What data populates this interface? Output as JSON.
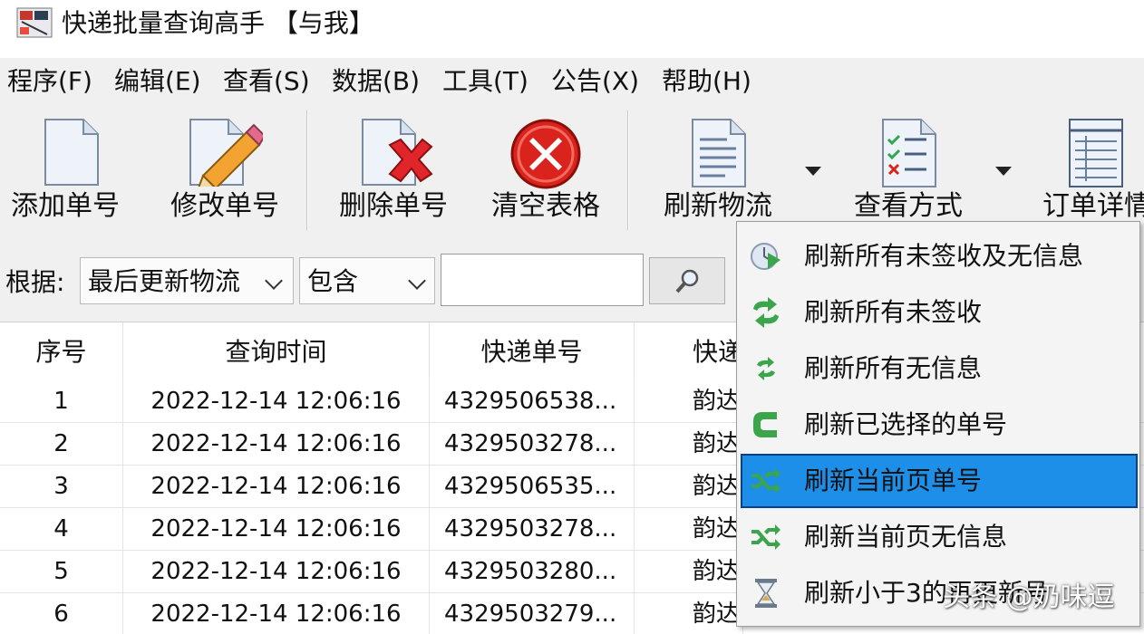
{
  "window": {
    "title": "快递批量查询高手 【与我】",
    "app_icon": "app-logo-icon"
  },
  "menubar": {
    "items": [
      "程序(F)",
      "编辑(E)",
      "查看(S)",
      "数据(B)",
      "工具(T)",
      "公告(X)",
      "帮助(H)"
    ]
  },
  "toolbar": {
    "buttons": [
      {
        "label": "添加单号",
        "icon": "document-icon"
      },
      {
        "label": "修改单号",
        "icon": "pencil-document-icon"
      },
      {
        "label": "删除单号",
        "icon": "delete-document-icon"
      },
      {
        "label": "清空表格",
        "icon": "clear-red-x-icon"
      },
      {
        "label": "刷新物流",
        "icon": "list-document-icon"
      },
      {
        "label": "查看方式",
        "icon": "checklist-icon"
      },
      {
        "label": "订单详情",
        "icon": "table-document-icon"
      }
    ]
  },
  "filter": {
    "label": "根据:",
    "field_select": "最后更新物流",
    "mode_select": "包含",
    "query_value": "",
    "search_icon": "magnifier-icon"
  },
  "table": {
    "headers": [
      "序号",
      "查询时间",
      "快递单号",
      "快递"
    ],
    "rows": [
      {
        "seq": "1",
        "time": "2022-12-14 12:06:16",
        "tracking": "4329506538...",
        "company": "韵达"
      },
      {
        "seq": "2",
        "time": "2022-12-14 12:06:16",
        "tracking": "4329503278...",
        "company": "韵达"
      },
      {
        "seq": "3",
        "time": "2022-12-14 12:06:16",
        "tracking": "4329506535...",
        "company": "韵达"
      },
      {
        "seq": "4",
        "time": "2022-12-14 12:06:16",
        "tracking": "4329503278...",
        "company": "韵达"
      },
      {
        "seq": "5",
        "time": "2022-12-14 12:06:16",
        "tracking": "4329503280...",
        "company": "韵达"
      },
      {
        "seq": "6",
        "time": "2022-12-14 12:06:16",
        "tracking": "4329503279...",
        "company": "韵达"
      }
    ]
  },
  "refresh_menu": {
    "items": [
      {
        "label": "刷新所有未签收及无信息",
        "icon": "clock-refresh-icon",
        "active": false
      },
      {
        "label": "刷新所有未签收",
        "icon": "cycle-arrows-icon",
        "active": false
      },
      {
        "label": "刷新所有无信息",
        "icon": "small-cycle-arrows-icon",
        "active": false
      },
      {
        "label": "刷新已选择的单号",
        "icon": "return-arrow-icon",
        "active": false
      },
      {
        "label": "刷新当前页单号",
        "icon": "shuffle-icon",
        "active": true
      },
      {
        "label": "刷新当前页无信息",
        "icon": "shuffle-icon",
        "active": false
      },
      {
        "label": "刷新小于3的再更新号",
        "icon": "hourglass-icon",
        "active": false
      }
    ]
  },
  "watermark": "头条 @奶味逗",
  "colors": {
    "menu_highlight": "#1e8fe8",
    "menu_highlight_border": "#0a3f8a",
    "toolbar_bg": "#f0f0f0",
    "icon_green": "#3aa54b",
    "icon_red": "#d9231c"
  }
}
